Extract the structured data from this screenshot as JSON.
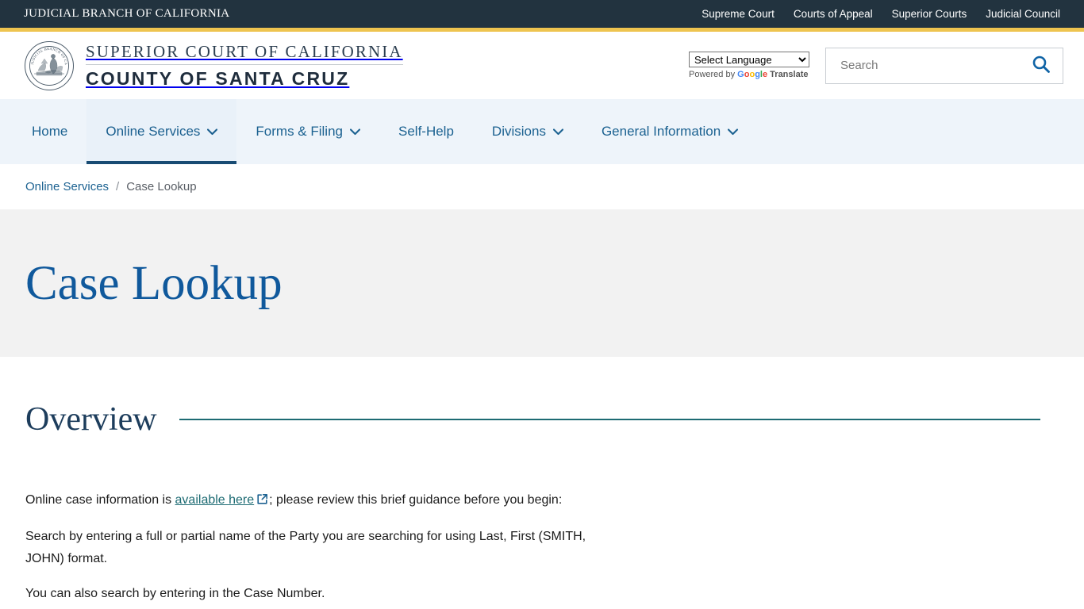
{
  "utility_bar": {
    "brand": "JUDICIAL BRANCH OF CALIFORNIA",
    "links": [
      {
        "label": "Supreme Court"
      },
      {
        "label": "Courts of Appeal"
      },
      {
        "label": "Superior Courts"
      },
      {
        "label": "Judicial Council"
      }
    ]
  },
  "masthead": {
    "seal_alt": "great-seal-of-california",
    "court_line1": "SUPERIOR COURT OF CALIFORNIA",
    "court_line2": "COUNTY OF SANTA CRUZ",
    "translate": {
      "selected": "Select Language",
      "options": [
        "Select Language"
      ],
      "powered_prefix": "Powered by",
      "google": "Google",
      "translate_word": "Translate"
    },
    "search": {
      "placeholder": "Search",
      "value": "",
      "icon": "search-icon"
    }
  },
  "nav": {
    "items": [
      {
        "label": "Home",
        "has_caret": false,
        "active": false
      },
      {
        "label": "Online Services",
        "has_caret": true,
        "active": true
      },
      {
        "label": "Forms & Filing",
        "has_caret": true,
        "active": false
      },
      {
        "label": "Self-Help",
        "has_caret": false,
        "active": false
      },
      {
        "label": "Divisions",
        "has_caret": true,
        "active": false
      },
      {
        "label": "General Information",
        "has_caret": true,
        "active": false
      }
    ]
  },
  "breadcrumb": {
    "parent": "Online Services",
    "separator": "/",
    "current": "Case Lookup"
  },
  "hero": {
    "title": "Case Lookup"
  },
  "overview": {
    "heading": "Overview",
    "intro_before_link": "Online case information is ",
    "link_text": "available here",
    "intro_after_link": "; please review this brief guidance before you begin:",
    "paragraph_2": "Search by entering a full or partial name of the Party you are searching for using Last, First (SMITH, JOHN) format.",
    "paragraph_3": "You can also search by entering in the Case Number."
  },
  "colors": {
    "utility_bg": "#22333f",
    "gold_rule": "#eec44f",
    "nav_bg": "#eef4fa",
    "nav_active_underline": "#184b73",
    "link_blue": "#1c6291",
    "title_blue": "#10599c",
    "teal_rule": "#1d6b73",
    "hero_bg": "#f2f2f2"
  }
}
